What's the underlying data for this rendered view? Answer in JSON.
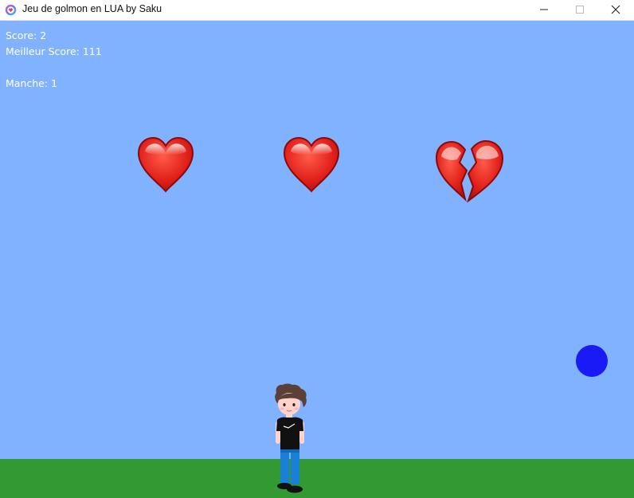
{
  "window": {
    "title": "Jeu de golmon en LUA by Saku",
    "app_icon": "heart-app-icon",
    "controls": [
      "minimize-icon",
      "maximize-icon",
      "close-icon"
    ]
  },
  "hud": {
    "score": "Score: 2",
    "best_score": "Meilleur Score: 111",
    "round": "Manche: 1"
  },
  "lives": {
    "icons": [
      "red-heart-icon",
      "red-heart-icon",
      "broken-heart-icon"
    ],
    "remaining": 2,
    "total": 3
  },
  "colors": {
    "sky": "#80b2ff",
    "ground": "#339933",
    "ball": "#1a1af5",
    "hud_text": "#ffffff"
  }
}
